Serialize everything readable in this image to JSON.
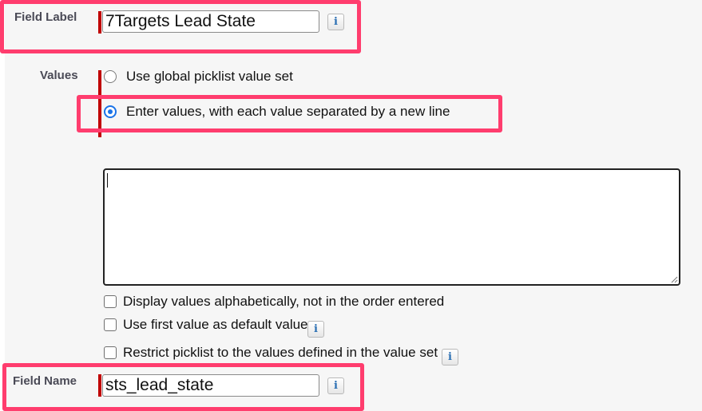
{
  "field_label": {
    "label": "Field Label",
    "value": "7Targets Lead State"
  },
  "values": {
    "label": "Values",
    "options": [
      "Use global picklist value set",
      "Enter values, with each value separated by a new line"
    ],
    "selected_index": 1,
    "textarea_value": ""
  },
  "checkboxes": [
    "Display values alphabetically, not in the order entered",
    "Use first value as default value",
    "Restrict picklist to the values defined in the value set"
  ],
  "field_name": {
    "label": "Field Name",
    "value": "sts_lead_state"
  },
  "info_icon_glyph": "i",
  "colors": {
    "highlight": "#ff3d6e",
    "required_bar": "#c00000",
    "radio_selected": "#1a73e8",
    "info_icon": "#2a6fb3"
  }
}
